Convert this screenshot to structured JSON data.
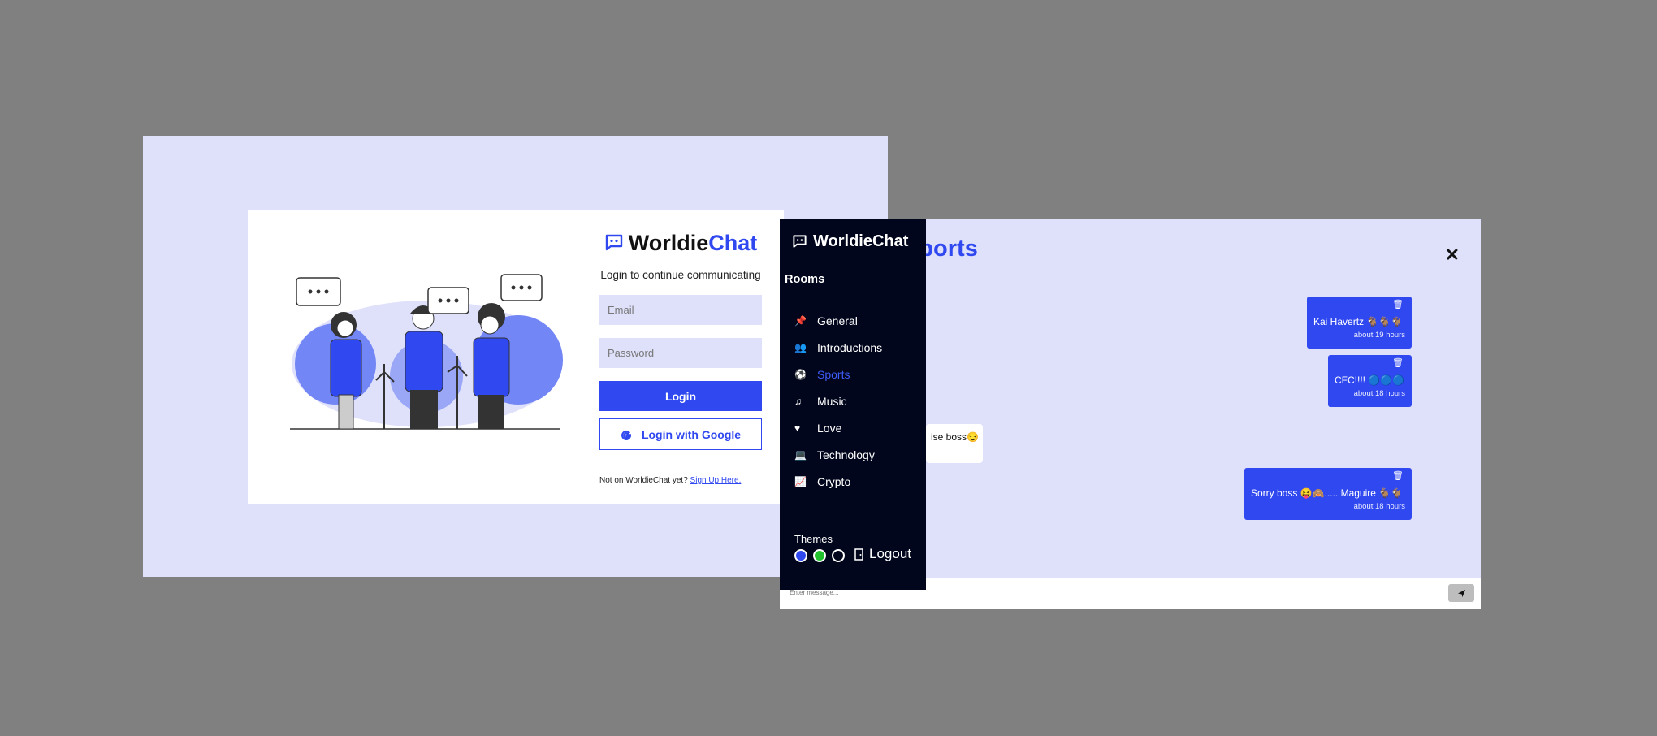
{
  "login": {
    "brand_part1": "Worldie",
    "brand_part2": "Chat",
    "tagline": "Login to continue communicating",
    "email_placeholder": "Email",
    "password_placeholder": "Password",
    "login_label": "Login",
    "google_label": "Login with Google",
    "signup_prompt": "Not on WorldieChat yet?",
    "signup_link": "Sign Up Here."
  },
  "chat": {
    "room_title": "Sports",
    "close_label": "✕",
    "messages": [
      {
        "text": "Kai Havertz 🐐🐐🐐",
        "time": "about 19 hours"
      },
      {
        "text": "CFC!!!! 🔵🔵🔵",
        "time": "about 18 hours"
      },
      {
        "text": "ise boss😏"
      },
      {
        "text": "Sorry boss 😝🙈..... Maguire 🐐🐐",
        "time": "about 18 hours"
      }
    ],
    "input_placeholder": "Enter message..."
  },
  "sidebar": {
    "brand": "WorldieChat",
    "rooms_heading": "Rooms",
    "rooms": [
      {
        "label": "General",
        "icon": "pin-icon"
      },
      {
        "label": "Introductions",
        "icon": "users-icon"
      },
      {
        "label": "Sports",
        "icon": "football-icon",
        "active": true
      },
      {
        "label": "Music",
        "icon": "music-icon"
      },
      {
        "label": "Love",
        "icon": "heart-icon"
      },
      {
        "label": "Technology",
        "icon": "laptop-icon"
      },
      {
        "label": "Crypto",
        "icon": "chart-icon"
      }
    ],
    "themes_label": "Themes",
    "themes": [
      "#3048ef",
      "#22c22e",
      "#02061c"
    ],
    "logout_label": "Logout"
  },
  "colors": {
    "accent": "#3048ef",
    "background": "#808080",
    "panel": "#dfe1fb",
    "sidebar": "#02061c"
  }
}
